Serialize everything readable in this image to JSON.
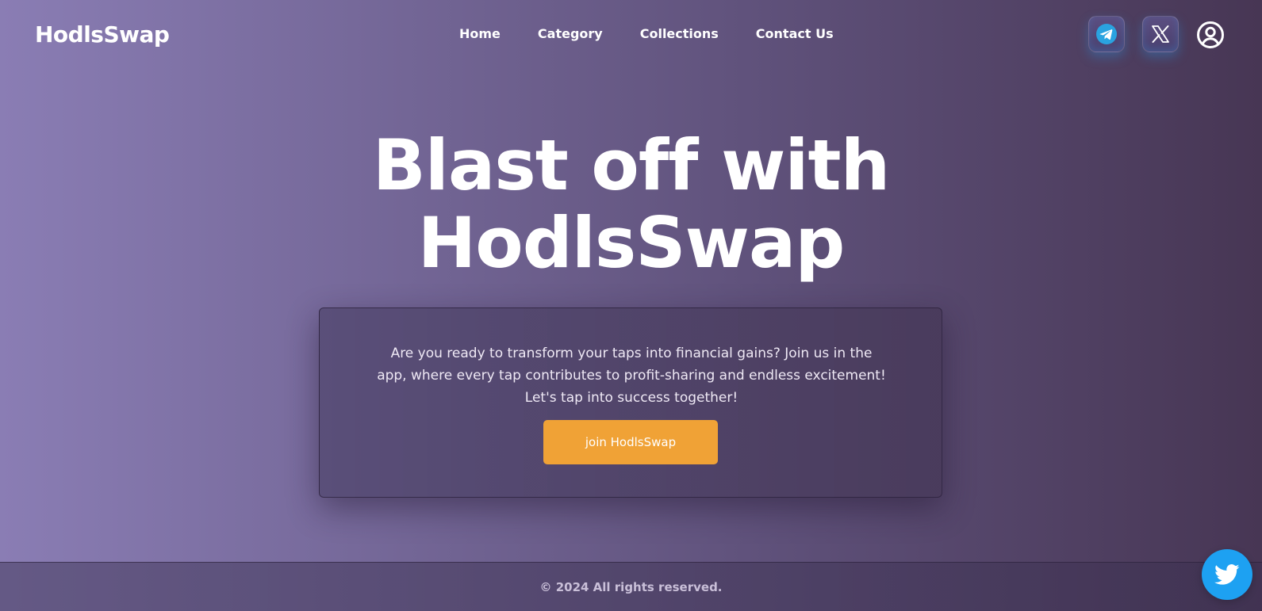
{
  "header": {
    "logo": "HodlsSwap",
    "nav": [
      {
        "label": "Home"
      },
      {
        "label": "Category"
      },
      {
        "label": "Collections"
      },
      {
        "label": "Contact Us"
      }
    ],
    "icons": [
      "telegram-icon",
      "x-icon",
      "user-icon"
    ]
  },
  "hero": {
    "title_line1": "Blast off with",
    "title_line2": "HodlsSwap",
    "description": "Are you ready to transform your taps into financial gains? Join us in the app, where every tap contributes to profit-sharing and endless excitement! Let's tap into success together!",
    "cta_label": "join HodlsSwap"
  },
  "footer": {
    "copyright": "© 2024 All rights reserved."
  },
  "floating": {
    "icon": "twitter-bird-icon"
  },
  "colors": {
    "accent": "#f0a236",
    "twitter_blue": "#1da1f2",
    "telegram_blue": "#2aa3e0",
    "background_start": "#8a7db4",
    "background_end": "#473654"
  }
}
